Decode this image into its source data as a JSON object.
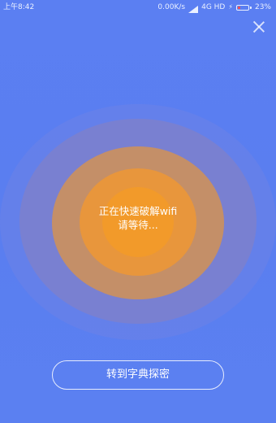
{
  "status_bar": {
    "time": "上午8:42",
    "network_speed": "0.00K/s",
    "network_type": "4G HD",
    "battery_percent": "23%",
    "battery_level": 0.23
  },
  "close": {
    "icon": "close-icon"
  },
  "radar": {
    "line1": "正在快速破解wifi",
    "line2": "请等待..."
  },
  "actions": {
    "dictionary_button": "转到字典探密"
  },
  "colors": {
    "background": "#5a7ef0",
    "ring_outer": "#7d80cd",
    "ring_mid": "#c48f68",
    "ring_inner": "#e8963c",
    "ring_core": "#f29a2a",
    "battery_low": "#ff4a4a"
  }
}
